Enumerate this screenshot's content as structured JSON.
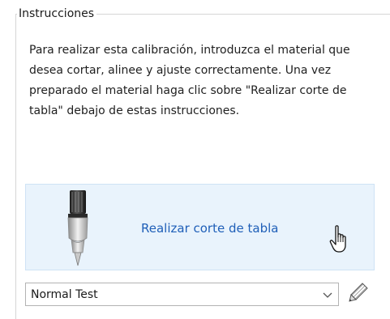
{
  "group": {
    "title": "Instrucciones"
  },
  "instructions": {
    "text": "Para realizar esta calibración, introduzca el material que desea cortar, alinee y ajuste correctamente. Una vez preparado el material haga clic sobre \"Realizar corte de tabla\" debajo de estas instrucciones."
  },
  "cut_panel": {
    "label": "Realizar corte de tabla",
    "tool_icon": "cutting-blade-icon",
    "cursor_icon": "hand-pointer-icon",
    "label_color": "#1f5fb8",
    "background_color": "#e9f3fc"
  },
  "test_select": {
    "selected": "Normal Test",
    "arrow_icon": "chevron-down-icon"
  },
  "edit_button": {
    "icon": "pencil-edit-icon"
  }
}
